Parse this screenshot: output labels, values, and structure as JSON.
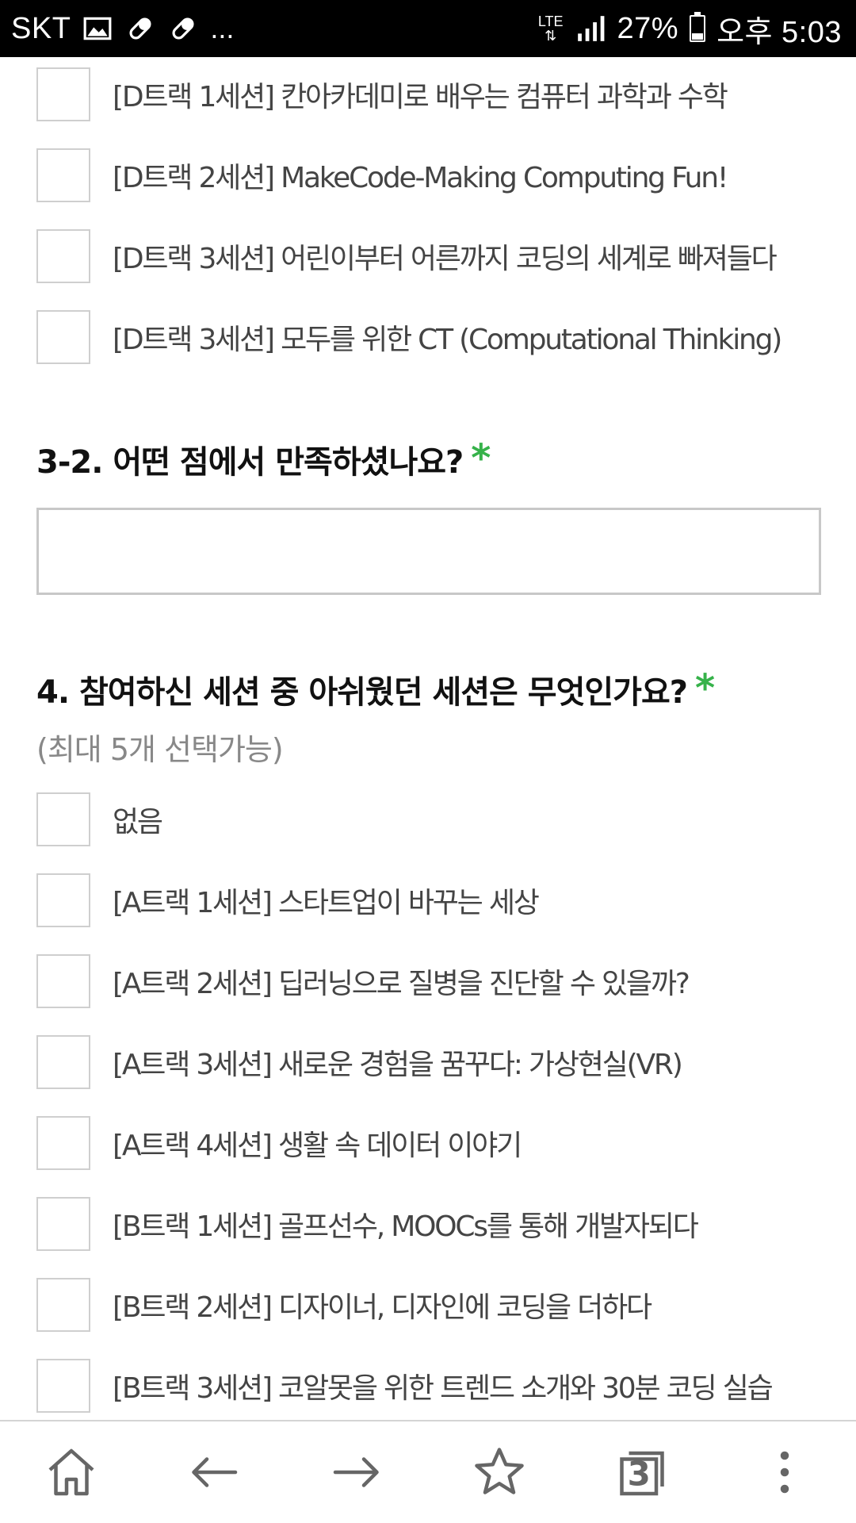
{
  "status_bar": {
    "carrier": "SKT",
    "notification_icons": [
      "image-icon",
      "pill-icon",
      "pill-icon"
    ],
    "more": "...",
    "network": "LTE",
    "battery": "27%",
    "battery_level": 0.27,
    "time": "오후 5:03"
  },
  "form": {
    "q3_options_tail": [
      "[D트랙 1세션] 칸아카데미로 배우는 컴퓨터 과학과 수학",
      "[D트랙 2세션] MakeCode-Making Computing Fun!",
      "[D트랙 3세션] 어린이부터 어른까지 코딩의 세계로 빠져들다",
      "[D트랙 3세션] 모두를 위한 CT (Computational Thinking)"
    ],
    "q3_2": {
      "label": "3-2. 어떤 점에서 만족하셨나요?",
      "required_mark": "*",
      "answer_value": ""
    },
    "q4": {
      "label": "4. 참여하신 세션 중 아쉬웠던 세션은 무엇인가요?",
      "required_mark": "*",
      "hint": "(최대 5개 선택가능)",
      "options": [
        "없음",
        "[A트랙 1세션] 스타트업이 바꾸는 세상",
        "[A트랙 2세션] 딥러닝으로 질병을 진단할 수 있을까?",
        "[A트랙 3세션] 새로운 경험을 꿈꾸다: 가상현실(VR)",
        "[A트랙 4세션] 생활 속 데이터 이야기",
        "[B트랙 1세션] 골프선수, MOOCs를 통해 개발자되다",
        "[B트랙 2세션] 디자이너, 디자인에 코딩을 더하다",
        "[B트랙 3세션] 코알못을 위한 트렌드 소개와 30분 코딩 실습"
      ]
    }
  },
  "bottom_nav": {
    "items": [
      "home-icon",
      "back-arrow-icon",
      "forward-arrow-icon",
      "bookmark-star-icon",
      "tabs-icon",
      "more-vert-icon"
    ],
    "tab_count": "3"
  },
  "colors": {
    "required_accent": "#36b24a",
    "status_bar_bg": "#000000",
    "checkbox_border": "#cfcfcf"
  }
}
